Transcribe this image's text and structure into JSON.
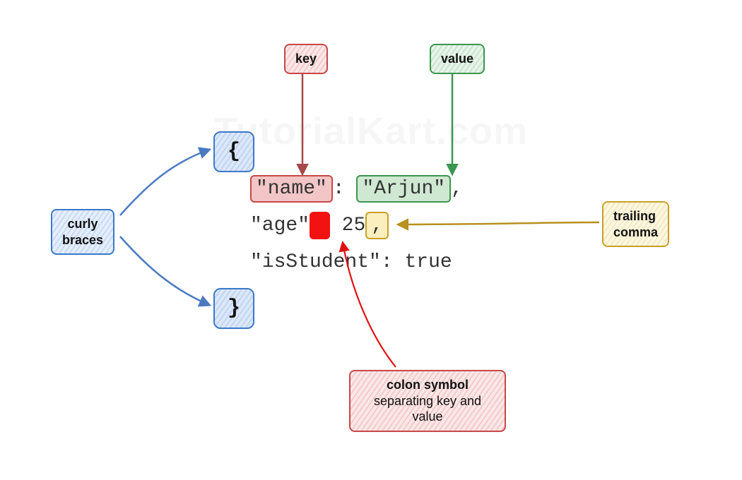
{
  "watermark": "TutorialKart.com",
  "labels": {
    "curly_braces": "curly\nbraces",
    "key": "key",
    "value": "value",
    "trailing_comma": "trailing\ncomma",
    "colon_title": "colon symbol",
    "colon_sub": "separating key and value"
  },
  "braces": {
    "open": "{",
    "close": "}"
  },
  "code": {
    "line1": {
      "key": "\"name\"",
      "colon": ":",
      "value": "\"Arjun\"",
      "trail": ","
    },
    "line2": {
      "key": "\"age\"",
      "colon": ":",
      "value": "25",
      "trail": ","
    },
    "line3": {
      "key": "\"isStudent\"",
      "colon": ":",
      "value": "true"
    }
  }
}
